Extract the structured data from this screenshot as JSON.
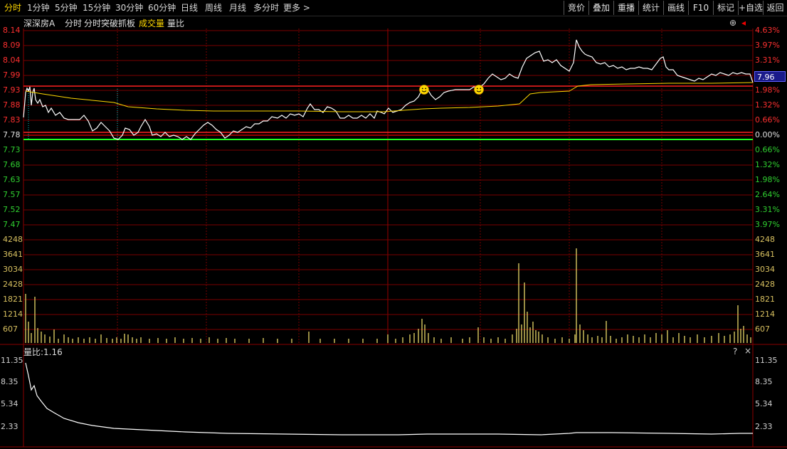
{
  "toolbar": {
    "tabs": [
      "分时",
      "1分钟",
      "5分钟",
      "15分钟",
      "30分钟",
      "60分钟",
      "日线",
      "周线",
      "月线",
      "多分时",
      "更多 >"
    ],
    "active_tab": "分时",
    "right_buttons": [
      "竞价",
      "叠加",
      "重播",
      "统计",
      "画线",
      "F10",
      "标记",
      "+自选",
      "返回"
    ]
  },
  "header": {
    "stock_name": "深深房A",
    "labels": [
      "分时",
      "分时突破抓板",
      "成交量",
      "量比"
    ]
  },
  "price_axis": {
    "left_ticks": [
      "8.14",
      "8.09",
      "8.04",
      "7.99",
      "7.93",
      "7.88",
      "7.83",
      "7.78",
      "7.73",
      "7.68",
      "7.63",
      "7.57",
      "7.52",
      "7.47"
    ],
    "right_ticks": [
      "4.63%",
      "3.97%",
      "3.31%",
      "2.65%",
      "1.98%",
      "1.32%",
      "0.66%",
      "0.00%",
      "0.66%",
      "1.32%",
      "1.98%",
      "2.64%",
      "3.31%",
      "3.97%"
    ],
    "current_price": "7.96"
  },
  "volume_axis": {
    "ticks": [
      "4248",
      "3641",
      "3034",
      "2428",
      "1821",
      "1214",
      "607"
    ]
  },
  "ratio_panel": {
    "title": "量比:1.16",
    "ticks": [
      "11.35",
      "8.35",
      "5.34",
      "2.33"
    ],
    "help_icon": "?",
    "close_icon": "×"
  },
  "colors": {
    "up": "#ff3030",
    "down": "#30d030",
    "price_line": "#ffffff",
    "avg_line": "#ffd800",
    "grid": "#8b0000",
    "volume": "#d8c860",
    "prev_close_line": "#ff2020",
    "support_line": "#20ff20"
  },
  "icons": {
    "signal": "smiley-icon"
  }
}
